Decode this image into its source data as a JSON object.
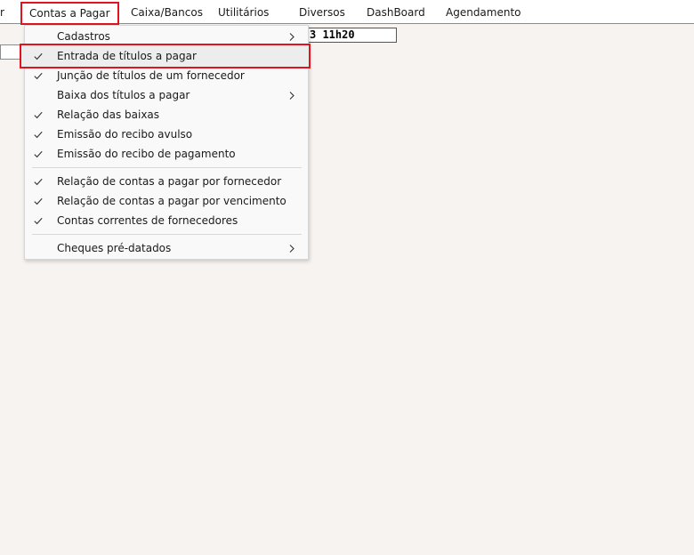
{
  "menubar": {
    "items": [
      {
        "label": "r"
      },
      {
        "label": "Contas a Pagar"
      },
      {
        "label": "Caixa/Bancos"
      },
      {
        "label": "Utilitários"
      },
      {
        "label": "Diversos"
      },
      {
        "label": "DashBoard"
      },
      {
        "label": "Agendamento"
      }
    ]
  },
  "info_field": {
    "value": "3 11h20"
  },
  "dropdown": {
    "items": [
      {
        "label": "Cadastros",
        "checked": false,
        "submenu": true
      },
      {
        "label": "Entrada de títulos a pagar",
        "checked": true,
        "submenu": false,
        "highlighted": true
      },
      {
        "label": "Junção de títulos de um fornecedor",
        "checked": true,
        "submenu": false
      },
      {
        "label": "Baixa dos títulos a pagar",
        "checked": false,
        "submenu": true
      },
      {
        "label": "Relação das baixas",
        "checked": true,
        "submenu": false
      },
      {
        "label": "Emissão do recibo avulso",
        "checked": true,
        "submenu": false
      },
      {
        "label": "Emissão do recibo de pagamento",
        "checked": true,
        "submenu": false
      },
      {
        "label": "Relação de contas a pagar por fornecedor",
        "checked": true,
        "submenu": false
      },
      {
        "label": "Relação de contas a pagar por vencimento",
        "checked": true,
        "submenu": false
      },
      {
        "label": "Contas correntes de fornecedores",
        "checked": true,
        "submenu": false
      },
      {
        "label": "Cheques pré-datados",
        "checked": false,
        "submenu": true
      }
    ]
  },
  "colors": {
    "highlight_box": "#e0141e",
    "background": "#f6f3f0",
    "menu_background": "#f9f9f9"
  }
}
